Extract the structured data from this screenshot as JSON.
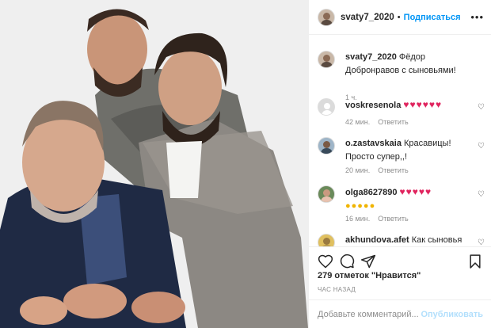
{
  "post": {
    "username": "svaty7_2020",
    "separator": "•",
    "follow_label": "Подписаться",
    "more_label": "•••",
    "caption": "Фёдор Добронравов с сыновьями!",
    "caption_time": "1 ч."
  },
  "comments": [
    {
      "user": "voskresenola",
      "text": "♥♥♥♥♥♥",
      "time": "42 мин.",
      "reply": "Ответить"
    },
    {
      "user": "o.zastavskaia",
      "text": "Красавицы! Просто супер,,!",
      "time": "20 мин.",
      "reply": "Ответить"
    },
    {
      "user": "olga8627890",
      "text": "♥♥♥♥♥",
      "text2": "●●●●●",
      "time": "16 мин.",
      "reply": "Ответить"
    },
    {
      "user": "akhundova.afet",
      "text": "Как сыновья"
    }
  ],
  "footer": {
    "likes": "279 отметок \"Нравится\"",
    "time_ago": "ЧАС НАЗАД",
    "comment_placeholder": "Добавьте комментарий...",
    "publish_label": "Опубликовать"
  },
  "icons": {
    "like": "heart-icon",
    "comment": "comment-icon",
    "share": "share-icon",
    "save": "bookmark-icon"
  },
  "colors": {
    "link": "#0095f6",
    "muted": "#8e8e8e",
    "heart_emoji": "#e0245e",
    "publish_disabled": "#b2dffc"
  }
}
